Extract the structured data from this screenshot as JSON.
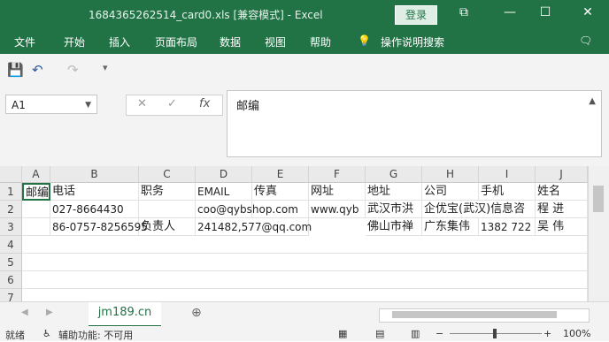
{
  "window": {
    "title": "1684365262514_card0.xls  [兼容模式]  -  Excel",
    "login_label": "登录",
    "ribbon_toggle_icon": "ribbon-display-icon",
    "minimize_icon": "minimize-icon",
    "maximize_icon": "maximize-icon",
    "close_icon": "close-icon"
  },
  "menu": {
    "items": [
      "文件",
      "开始",
      "插入",
      "页面布局",
      "数据",
      "视图",
      "帮助"
    ],
    "tell_me": "操作说明搜索",
    "comment_icon": "comment-icon"
  },
  "quick_access": {
    "icons": [
      "save-icon",
      "undo-icon",
      "redo-icon",
      "customize-icon"
    ]
  },
  "formula_bar": {
    "name_box": "A1",
    "cancel_glyph": "✕",
    "enter_glyph": "✓",
    "fx_glyph": "fx",
    "content": "邮编"
  },
  "grid": {
    "columns": [
      "A",
      "B",
      "C",
      "D",
      "E",
      "F",
      "G",
      "H",
      "I",
      "J"
    ],
    "rows": [
      "1",
      "2",
      "3",
      "4",
      "5",
      "6",
      "7"
    ],
    "row1": [
      "邮编",
      "电话",
      "职务",
      "EMAIL",
      "传真",
      "网址",
      "地址",
      "公司",
      "手机",
      "姓名"
    ],
    "row2": [
      "",
      "027-8664430",
      "",
      "coo@qybshop.com",
      "",
      "www.qyb",
      "武汉市洪",
      "企优宝(武汉)信息咨",
      "",
      "程    进"
    ],
    "row3": [
      "",
      "86-0757-8256595",
      "负责人",
      "241482,577@qq.com",
      "",
      "",
      "佛山市禅",
      "广东集伟",
      "1382    722",
      "吴    伟"
    ]
  },
  "sheets": {
    "active": "jm189.cn",
    "add_icon": "add-sheet-icon"
  },
  "status": {
    "ready": "就绪",
    "accessibility": "辅助功能: 不可用",
    "zoom": "100%"
  },
  "colors": {
    "accent": "#217346"
  }
}
